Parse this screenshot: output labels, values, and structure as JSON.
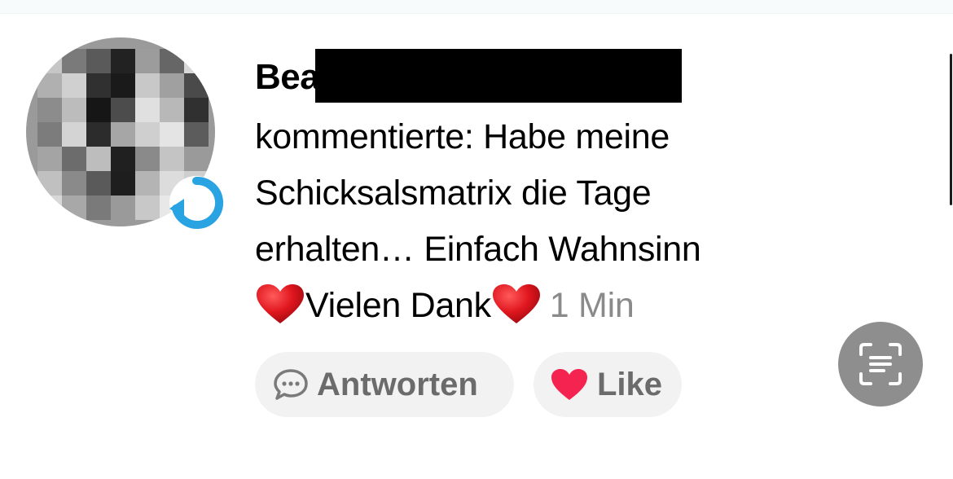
{
  "comment": {
    "username_visible": "Bea",
    "text_line1": "kommentierte: Habe meine",
    "text_line2": "Schicksalsmatrix die Tage",
    "text_line3": "erhalten… Einfach Wahnsinn",
    "text_line4": "Vielen Dank",
    "timestamp": "1 Min"
  },
  "actions": {
    "reply_label": "Antworten",
    "like_label": "Like"
  },
  "icons": {
    "reply": "speech-bubble-icon",
    "like": "heart-icon",
    "emoji": "red-heart-emoji",
    "scan": "live-text-scan-icon"
  },
  "colors": {
    "like_heart": "#f5234f",
    "badge_ring": "#2aa3e3",
    "pill_bg": "#f2f2f2",
    "timestamp": "#8a8a8a"
  }
}
